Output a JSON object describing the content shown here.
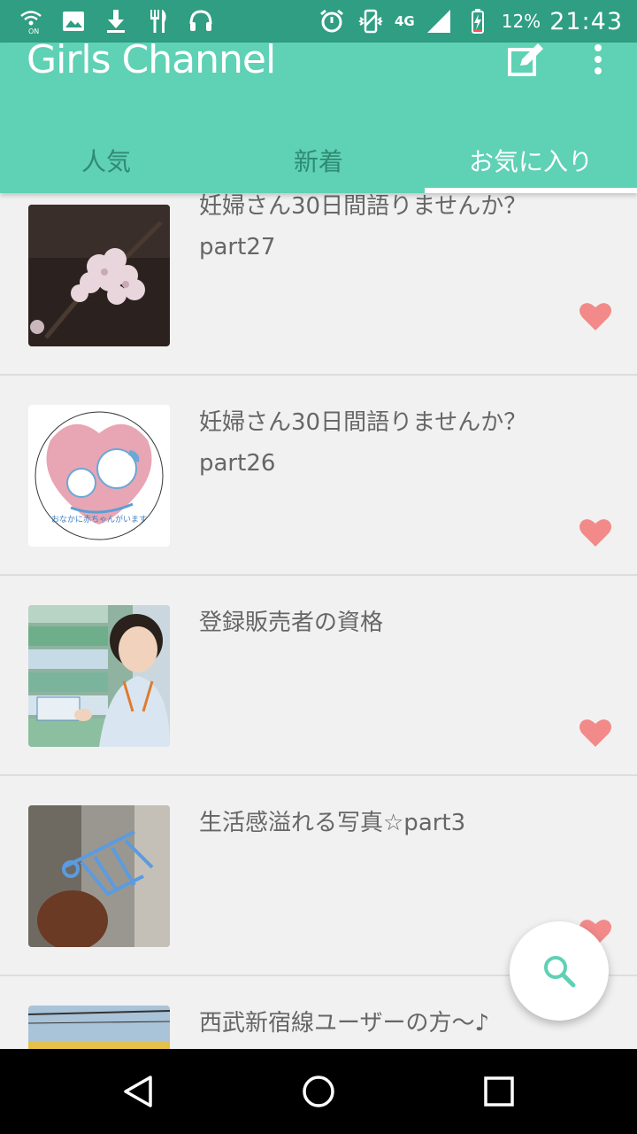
{
  "status_bar": {
    "left_icons": [
      "wifi-calling-icon",
      "image-icon",
      "download-icon",
      "restaurant-icon",
      "headset-icon"
    ],
    "right_icons": [
      "alarm-icon",
      "vibrate-icon",
      "signal-icon"
    ],
    "network": "4G",
    "battery": "12%",
    "time": "21:43"
  },
  "app_bar": {
    "title": "Girls Channel",
    "actions": [
      "edit-icon",
      "more-vert-icon"
    ]
  },
  "tabs": [
    {
      "label": "人気",
      "active": false
    },
    {
      "label": "新着",
      "active": false
    },
    {
      "label": "お気に入り",
      "active": true
    }
  ],
  "topics": [
    {
      "title": "妊婦さん30日間語りませんか？part27",
      "thumbnail": "cherry-blossom-photo",
      "favorited": true
    },
    {
      "title": "妊婦さん30日間語りませんか？part26",
      "thumbnail": "maternity-mark-image",
      "thumbnail_text": "おなかに赤ちゃんがいます",
      "favorited": true
    },
    {
      "title": "登録販売者の資格",
      "thumbnail": "pharmacy-clerk-photo",
      "favorited": true
    },
    {
      "title": "生活感溢れる写真☆part3",
      "thumbnail": "hanger-photo",
      "favorited": true
    },
    {
      "title": "西武新宿線ユーザーの方〜♪",
      "thumbnail": "train-photo",
      "favorited": true
    }
  ],
  "colors": {
    "primary": "#5fd1b5",
    "status_bar": "#2f9e83",
    "heart": "#f28a8a",
    "tab_inactive": "#2f8b72"
  },
  "fab": {
    "icon": "search-icon"
  },
  "nav_bar": {
    "buttons": [
      "back-icon",
      "home-icon",
      "recents-icon"
    ]
  }
}
